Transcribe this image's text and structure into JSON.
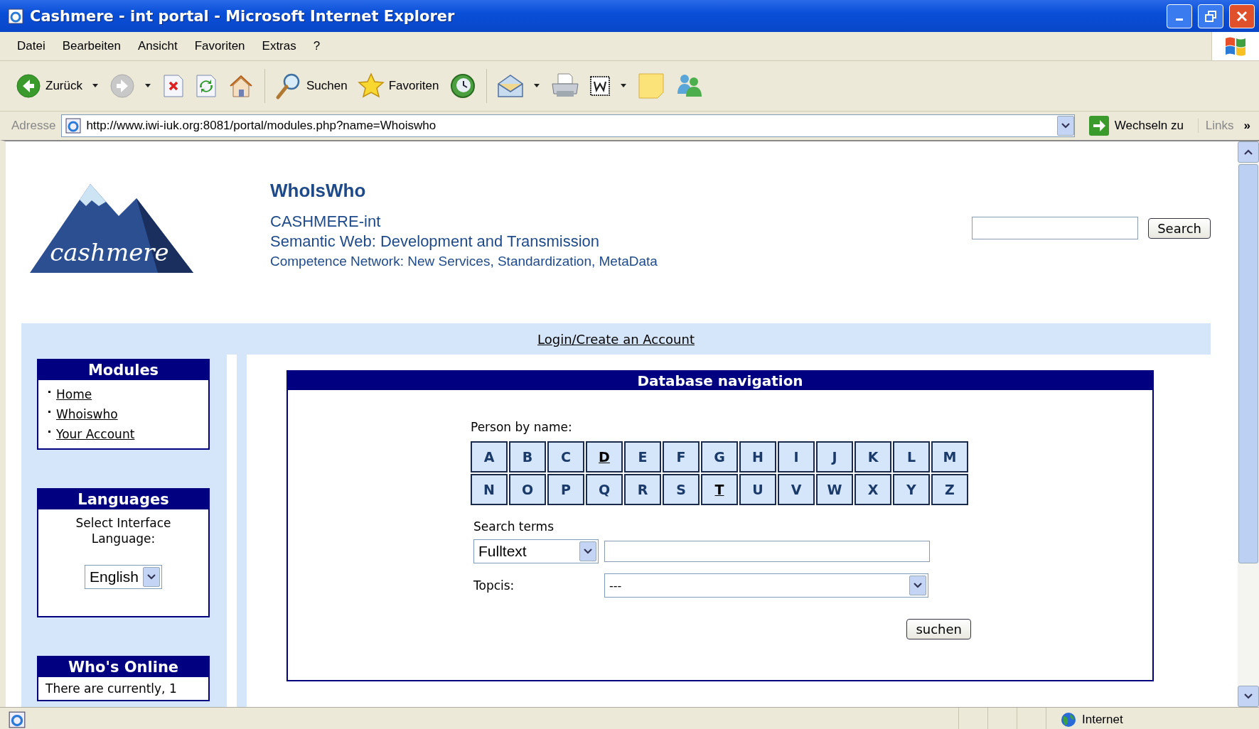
{
  "window": {
    "title": "Cashmere - int portal - Microsoft Internet Explorer"
  },
  "menu": [
    "Datei",
    "Bearbeiten",
    "Ansicht",
    "Favoriten",
    "Extras",
    "?"
  ],
  "toolbar": [
    {
      "kind": "back",
      "label": "Zurück",
      "dropdown": true
    },
    {
      "kind": "forward",
      "dropdown": true
    },
    {
      "kind": "stop"
    },
    {
      "kind": "refresh"
    },
    {
      "kind": "home"
    },
    {
      "kind": "search",
      "label": "Suchen"
    },
    {
      "kind": "favorites",
      "label": "Favoriten"
    },
    {
      "kind": "history"
    },
    {
      "kind": "mail",
      "dropdown": true
    },
    {
      "kind": "print"
    },
    {
      "kind": "word",
      "dropdown": true
    },
    {
      "kind": "note"
    },
    {
      "kind": "messenger"
    }
  ],
  "address": {
    "label": "Adresse",
    "url": "http://www.iwi-iuk.org:8081/portal/modules.php?name=Whoiswho",
    "go": "Wechseln zu",
    "links": "Links",
    "more": "»"
  },
  "header": {
    "logo": "cashmere",
    "title": "WhoIsWho",
    "lines": [
      "CASHMERE-int",
      "Semantic Web: Development and Transmission",
      "Competence Network: New Services, Standardization, MetaData"
    ],
    "search_button": "Search"
  },
  "login_link": "Login/Create an Account",
  "sidebar": [
    {
      "kind": "links",
      "title": "Modules",
      "items": [
        "Home",
        "Whoiswho",
        "Your Account"
      ]
    },
    {
      "kind": "language",
      "title": "Languages",
      "text": "Select Interface Language:",
      "value": "English"
    },
    {
      "kind": "text",
      "title": "Who's Online",
      "text": "There are currently, 1"
    }
  ],
  "main": {
    "title": "Database navigation",
    "person_label": "Person by name:",
    "letters": [
      {
        "letter": "A",
        "linked": false
      },
      {
        "letter": "B",
        "linked": false
      },
      {
        "letter": "C",
        "linked": false
      },
      {
        "letter": "D",
        "linked": true
      },
      {
        "letter": "E",
        "linked": false
      },
      {
        "letter": "F",
        "linked": false
      },
      {
        "letter": "G",
        "linked": false
      },
      {
        "letter": "H",
        "linked": false
      },
      {
        "letter": "I",
        "linked": false
      },
      {
        "letter": "J",
        "linked": false
      },
      {
        "letter": "K",
        "linked": false
      },
      {
        "letter": "L",
        "linked": false
      },
      {
        "letter": "M",
        "linked": false
      },
      {
        "letter": "N",
        "linked": false
      },
      {
        "letter": "O",
        "linked": false
      },
      {
        "letter": "P",
        "linked": false
      },
      {
        "letter": "Q",
        "linked": false
      },
      {
        "letter": "R",
        "linked": false
      },
      {
        "letter": "S",
        "linked": false
      },
      {
        "letter": "T",
        "linked": true
      },
      {
        "letter": "U",
        "linked": false
      },
      {
        "letter": "V",
        "linked": false
      },
      {
        "letter": "W",
        "linked": false
      },
      {
        "letter": "X",
        "linked": false
      },
      {
        "letter": "Y",
        "linked": false
      },
      {
        "letter": "Z",
        "linked": false
      }
    ],
    "search_label": "Search terms",
    "search_type": "Fulltext",
    "topics_label": "Topcis:",
    "topics_value": "---",
    "submit": "suchen"
  },
  "status": {
    "zone": "Internet"
  }
}
